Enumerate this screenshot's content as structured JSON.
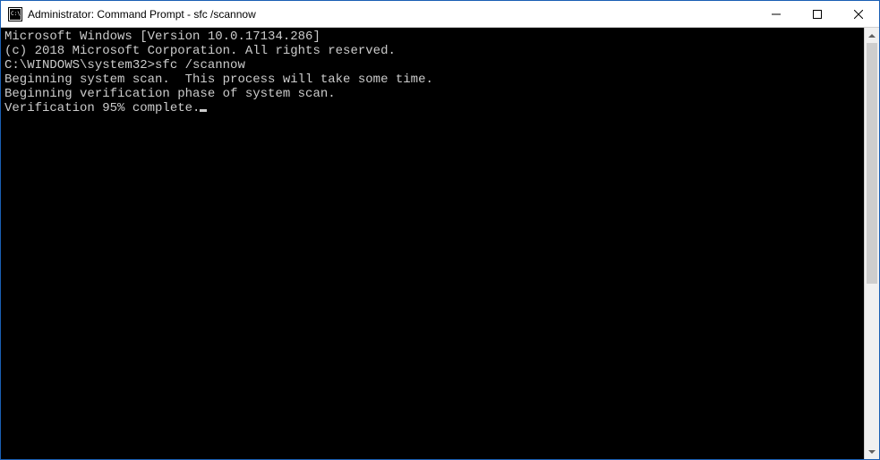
{
  "window": {
    "title": "Administrator: Command Prompt - sfc  /scannow"
  },
  "terminal": {
    "lines": {
      "l0": "Microsoft Windows [Version 10.0.17134.286]",
      "l1": "(c) 2018 Microsoft Corporation. All rights reserved.",
      "l2": "",
      "l3_prompt": "C:\\WINDOWS\\system32>",
      "l3_cmd": "sfc /scannow",
      "l4": "",
      "l5": "Beginning system scan.  This process will take some time.",
      "l6": "",
      "l7": "Beginning verification phase of system scan.",
      "l8": "Verification 95% complete."
    }
  }
}
